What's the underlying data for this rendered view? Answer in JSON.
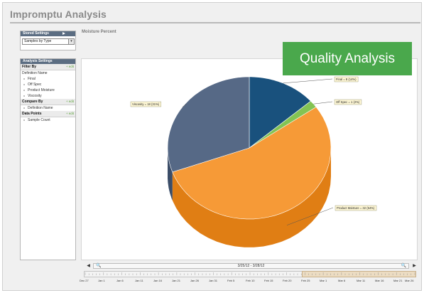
{
  "app": {
    "title": "Impromptu Analysis"
  },
  "stored_settings": {
    "header": "Stored Settings",
    "selected": "Samples by Type"
  },
  "analysis_settings": {
    "header": "Analysis Settings",
    "filter_by": {
      "label": "Filter By",
      "edit": "edit"
    },
    "definition_name": "Definition Name",
    "filter_items": [
      "Final",
      "Off Spec",
      "Product Moisture",
      "Viscosity"
    ],
    "compare_by": {
      "label": "Compare By",
      "edit": "edit"
    },
    "compare_items": [
      "Definition Name"
    ],
    "data_points": {
      "label": "Data Points",
      "edit": "edit"
    },
    "data_items": [
      "Sample Count"
    ]
  },
  "chart_title": "Moisture Percent",
  "badge": "Quality Analysis",
  "navigator": {
    "range": "3/25/12 - 3/28/12"
  },
  "timeline": {
    "labels": [
      "Dec 27",
      "Jan 1",
      "Jan 6",
      "Jan 11",
      "Jan 16",
      "Jan 21",
      "Jan 26",
      "Jan 31",
      "Feb 5",
      "Feb 10",
      "Feb 15",
      "Feb 20",
      "Feb 25",
      "Mar 1",
      "Mar 6",
      "Mar 11",
      "Mar 16",
      "Mar 21",
      "Mar 26"
    ]
  },
  "chart_data": {
    "type": "pie",
    "title": "Moisture Percent",
    "categories": [
      "Final",
      "Off Spec",
      "Product Moisture",
      "Viscosity"
    ],
    "values": [
      8,
      1,
      32,
      18
    ],
    "percents": [
      14,
      2,
      54,
      31
    ],
    "labels": [
      "Final = 8 (14%)",
      "Off Spec = 1 (2%)",
      "Product Moisture = 32 (54%)",
      "Viscosity = 18 (31%)"
    ],
    "colors": [
      "#0d4876",
      "#7cc04a",
      "#f5952c",
      "#4d6180"
    ],
    "side_colors": [
      "#0a3a61",
      "#5e9a35",
      "#e07e14",
      "#3b4d68"
    ]
  }
}
